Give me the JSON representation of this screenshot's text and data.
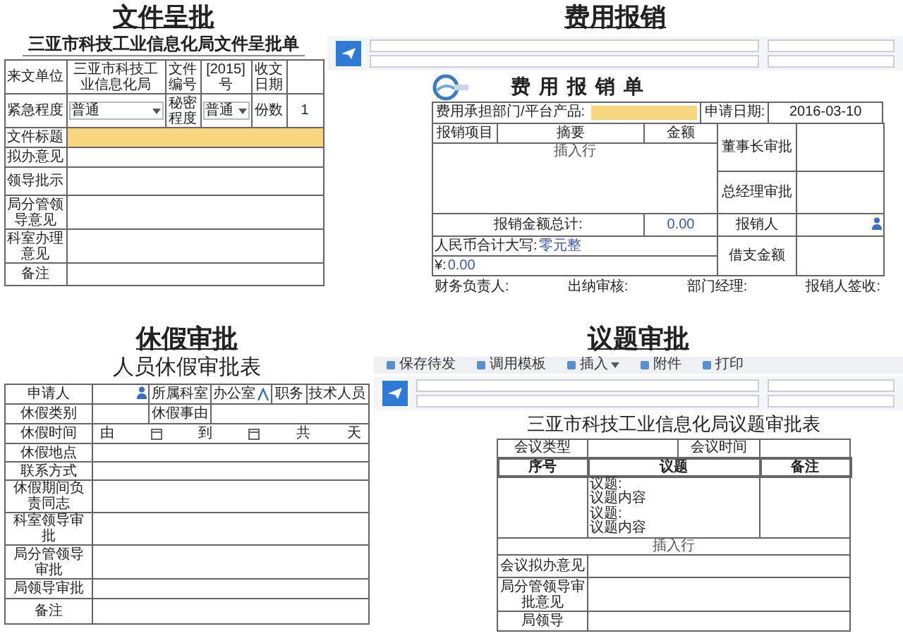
{
  "file_approval": {
    "heading": "文件呈批",
    "form_title": "三亚市科技工业信息化局文件呈批单",
    "sender": {
      "label": "来文单位",
      "value": "三亚市科技工业信息化局"
    },
    "doc_number": {
      "label": "文件编号",
      "year": "[2015]",
      "suffix": "号"
    },
    "received_date": {
      "label": "收文日期"
    },
    "urgency": {
      "label": "紧急程度",
      "value": "普通"
    },
    "secrecy": {
      "label": "秘密程度",
      "value": "普通"
    },
    "copies": {
      "label": "份数",
      "value": "1"
    },
    "title_field": {
      "label": "文件标题",
      "highlighted": true
    },
    "opinion_rows": [
      {
        "label": "拟办意见"
      },
      {
        "label": "领导批示"
      },
      {
        "label": "局分管领导意见"
      },
      {
        "label": "科室办理意见"
      },
      {
        "label": "备注"
      }
    ]
  },
  "expense_claim": {
    "heading": "费用报销",
    "form_title": "费用报销单",
    "dept_label": "费用承担部门/平台产品:",
    "dept_highlighted": true,
    "apply_date_label": "申请日期:",
    "apply_date": "2016-03-10",
    "item_columns": [
      "报销项目",
      "摘要",
      "金额"
    ],
    "insert_row": "插入行",
    "approvals": [
      {
        "label": "董事长审批"
      },
      {
        "label": "总经理审批"
      }
    ],
    "total_label": "报销金额总计:",
    "total": "0.00",
    "claimant_label": "报销人",
    "amount_words_label": "人民币合计大写:",
    "amount_words": "零元整",
    "yen_label": "¥:",
    "yen": "0.00",
    "advance_label": "借支金额",
    "signatures": [
      "财务负责人:",
      "出纳审核:",
      "部门经理:",
      "报销人签收:"
    ]
  },
  "leave_approval": {
    "heading": "休假审批",
    "form_title": "人员休假审批表",
    "applicant_label": "申请人",
    "dept_label": "所属科室",
    "dept": "办公室",
    "position_label": "职务",
    "position": "技术人员",
    "type_label": "休假类别",
    "reason_label": "休假事由",
    "period_label": "休假时间",
    "from": "由",
    "to": "到",
    "total": "共",
    "days": "天",
    "rows": [
      {
        "label": "休假地点"
      },
      {
        "label": "联系方式"
      },
      {
        "label": "休假期间负责同志"
      }
    ],
    "approvals": [
      {
        "label": "科室领导审批"
      },
      {
        "label": "局分管领导审批"
      },
      {
        "label": "局领导审批"
      },
      {
        "label": "备注"
      }
    ]
  },
  "topic_approval": {
    "heading": "议题审批",
    "toolbar": [
      {
        "label": "保存待发",
        "dropdown": false
      },
      {
        "label": "调用模板",
        "dropdown": false
      },
      {
        "label": "插入",
        "dropdown": true
      },
      {
        "label": "附件",
        "dropdown": false
      },
      {
        "label": "打印",
        "dropdown": false
      }
    ],
    "form_title": "三亚市科技工业信息化局议题审批表",
    "meeting_type_label": "会议类型",
    "meeting_time_label": "会议时间",
    "columns": [
      "序号",
      "议题",
      "备注"
    ],
    "topic_lines": [
      "议题:",
      "议题内容",
      "议题:",
      "议题内容"
    ],
    "insert_row": "插入行",
    "approvals": [
      {
        "label": "会议拟办意见"
      },
      {
        "label": "局分管领导审批意见"
      },
      {
        "label": "局领导"
      }
    ]
  }
}
